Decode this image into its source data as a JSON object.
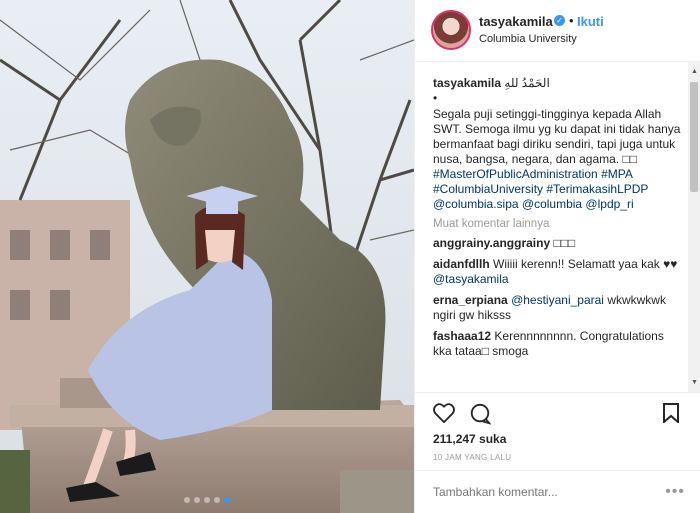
{
  "header": {
    "username": "tasyakamila",
    "follow_label": "Ikuti",
    "location": "Columbia University",
    "separator": "•"
  },
  "caption": {
    "username": "tasyakamila",
    "arabic": "الحَمْدُ للهِ",
    "bullet": "•",
    "text": "Segala puji setinggi-tingginya kepada Allah SWT. Semoga ilmu yg ku dapat ini tidak hanya bermanfaat bagi diriku sendiri, tapi juga untuk nusa, bangsa, negara, dan agama. □□",
    "tags": "#MasterOfPublicAdministration #MPA #ColumbiaUniversity #TerimakasihLPDP @columbia.sipa @columbia @lpdp_ri"
  },
  "load_more": "Muat komentar lainnya",
  "comments": [
    {
      "user": "anggrainy.anggrainy",
      "text": "□□□",
      "tag": ""
    },
    {
      "user": "aidanfdllh",
      "text": "Wiiiii kerenn!! Selamatt yaa kak ♥♥",
      "tag": "@tasyakamila"
    },
    {
      "user": "erna_erpiana",
      "text": "wkwkwkwk ngiri gw hiksss",
      "tag": "@hestiyani_parai"
    },
    {
      "user": "fashaaa12",
      "text": "Kerennnnnnnn. Congratulations kka tataa□ smoga",
      "tag": ""
    }
  ],
  "likes": "211,247 suka",
  "time": "10 JAM YANG LALU",
  "add_comment_placeholder": "Tambahkan komentar...",
  "more_options": "•••",
  "icons": {
    "like": "heart-icon",
    "comment": "comment-icon",
    "save": "bookmark-icon",
    "verified": "verified-badge-icon"
  },
  "colors": {
    "accent": "#3897f0",
    "link": "#003569",
    "muted": "#999999",
    "text": "#262626"
  }
}
